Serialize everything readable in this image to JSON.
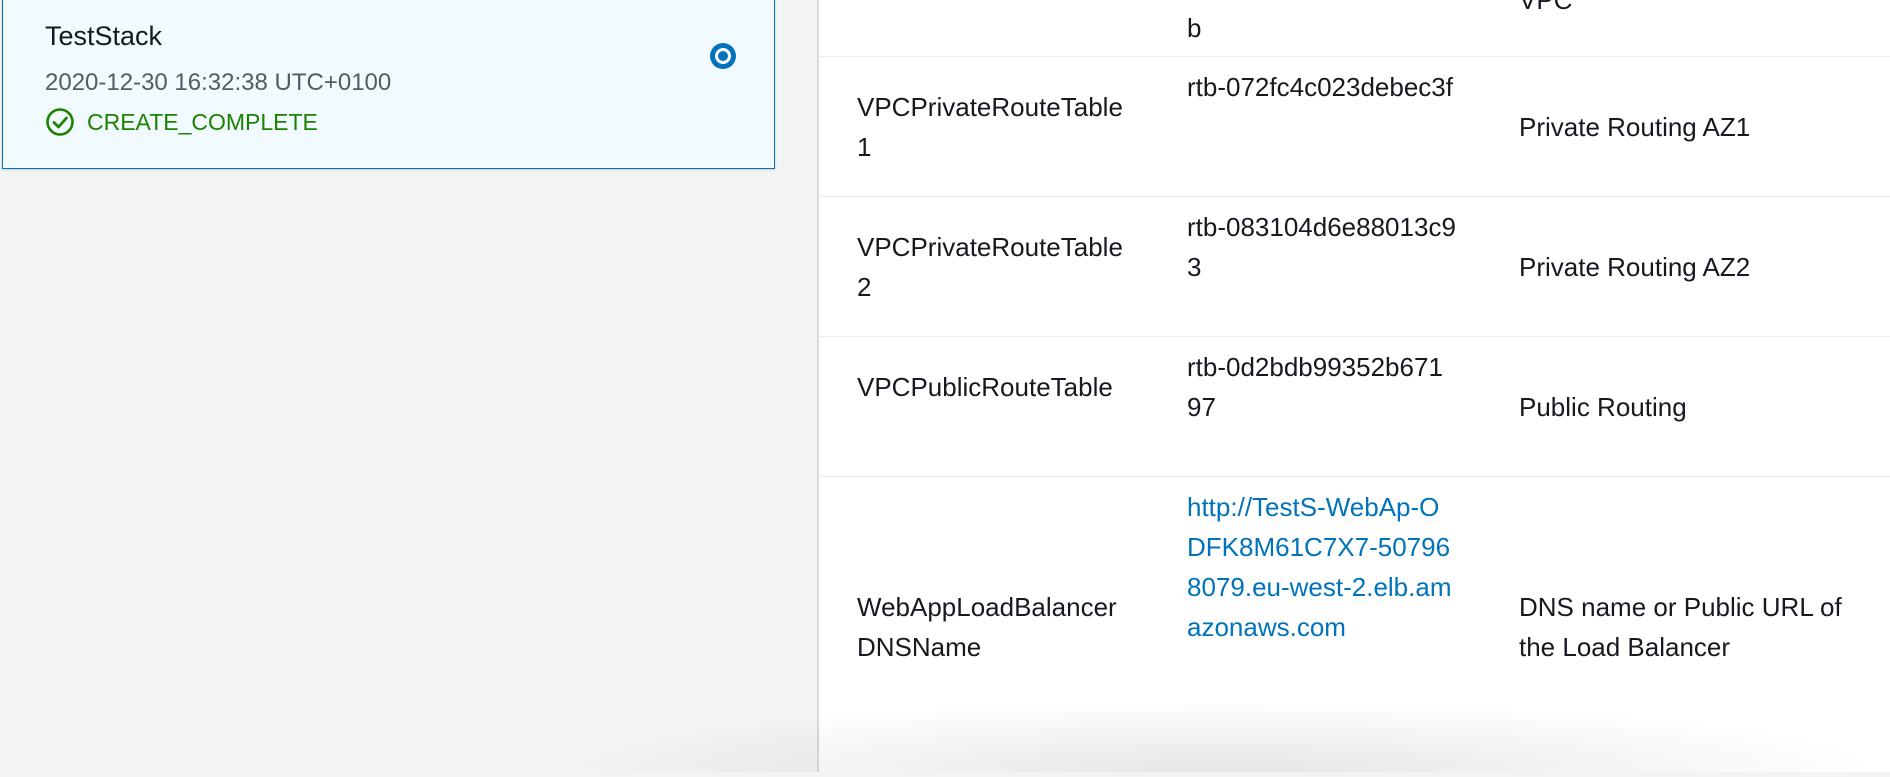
{
  "stack": {
    "name": "TestStack",
    "created": "2020-12-30 16:32:38 UTC+0100",
    "status": "CREATE_COMPLETE",
    "status_color": "#1d8102",
    "selected": true,
    "accent_color": "#0073bb"
  },
  "outputs": {
    "rows": [
      {
        "key": "",
        "value": "b",
        "description": "VPC"
      },
      {
        "key": "VPCPrivateRouteTable1",
        "value": "rtb-072fc4c023debec3f",
        "description": "Private Routing AZ1"
      },
      {
        "key": "VPCPrivateRouteTable2",
        "value": "rtb-083104d6e88013c93",
        "description": "Private Routing AZ2"
      },
      {
        "key": "VPCPublicRouteTable",
        "value": "rtb-0d2bdb99352b67197",
        "description": "Public Routing"
      },
      {
        "key": "WebAppLoadBalancerDNSName",
        "value": "http://TestS-WebAp-ODFK8M61C7X7-507968079.eu-west-2.elb.amazonaws.com",
        "description": "DNS name or Public URL of the Load Balancer",
        "value_is_link": true
      }
    ]
  }
}
